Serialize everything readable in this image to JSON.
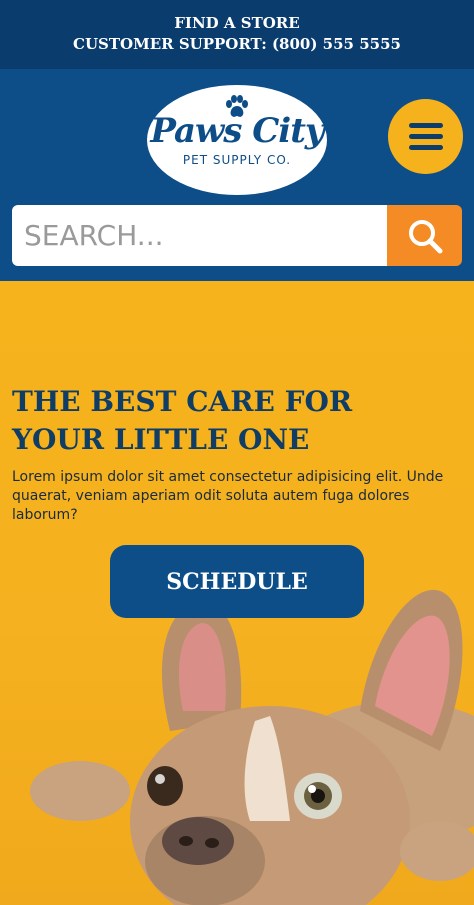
{
  "topbar": {
    "find_store": "FIND A STORE",
    "support": "CUSTOMER SUPPORT: (800) 555 5555"
  },
  "logo": {
    "name": "Paws City",
    "sub": "PET SUPPLY CO."
  },
  "search": {
    "placeholder": "SEARCH...",
    "icon": "search-icon"
  },
  "menu": {
    "icon": "hamburger-menu-icon"
  },
  "hero": {
    "title": "THE BEST CARE FOR YOUR LITTLE ONE",
    "text": "Lorem ipsum dolor sit amet consectetur adipisicing elit. Unde quaerat, veniam aperiam odit soluta autem fuga dolores laborum?",
    "button": "SCHEDULE",
    "image": "french-bulldog-puppy-photo"
  },
  "colors": {
    "navy_dark": "#0a3c6e",
    "navy": "#0d4e89",
    "yellow": "#f6b21d",
    "orange": "#f48b24"
  }
}
